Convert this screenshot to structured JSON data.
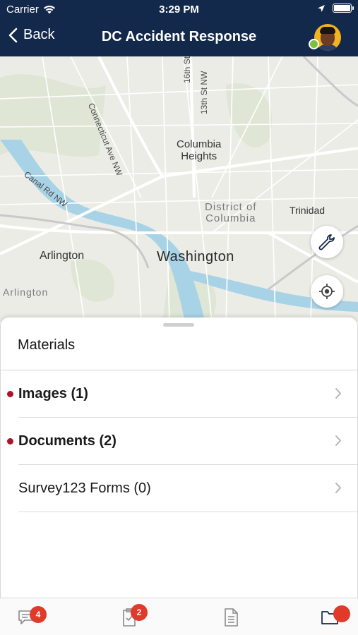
{
  "status_bar": {
    "carrier": "Carrier",
    "time": "3:29 PM",
    "icons": [
      "wifi-icon",
      "location-arrow-icon",
      "battery-icon"
    ]
  },
  "nav": {
    "back_label": "Back",
    "title": "DC Accident Response",
    "presence_color": "#7ac143"
  },
  "map": {
    "labels": {
      "connecticut": "Connecticut Ave NW",
      "sixteenth": "16th St NW",
      "thirteenth": "13th St NW",
      "columbia_heights_1": "Columbia",
      "columbia_heights_2": "Heights",
      "canal": "Canal Rd NW",
      "district_1": "District of",
      "district_2": "Columbia",
      "trinidad": "Trinidad",
      "arlington_north": "Arlington",
      "washington": "Washington",
      "arlington_south": "Arlington"
    },
    "buttons": [
      "wrench-icon",
      "locate-icon"
    ]
  },
  "materials": {
    "title": "Materials",
    "items": [
      {
        "label": "Images (1)",
        "has_indicator": true,
        "bold": true
      },
      {
        "label": "Documents (2)",
        "has_indicator": true,
        "bold": true
      },
      {
        "label": "Survey123 Forms (0)",
        "has_indicator": false,
        "bold": false
      }
    ],
    "indicator_color": "#b3102a"
  },
  "tabbar": {
    "tabs": [
      {
        "icon": "chat-icon",
        "badge": "4"
      },
      {
        "icon": "clipboard-check-icon",
        "badge": "2"
      },
      {
        "icon": "document-icon",
        "badge": ""
      },
      {
        "icon": "folder-icon",
        "badge": ""
      }
    ],
    "badge_color": "#e03a2b"
  }
}
